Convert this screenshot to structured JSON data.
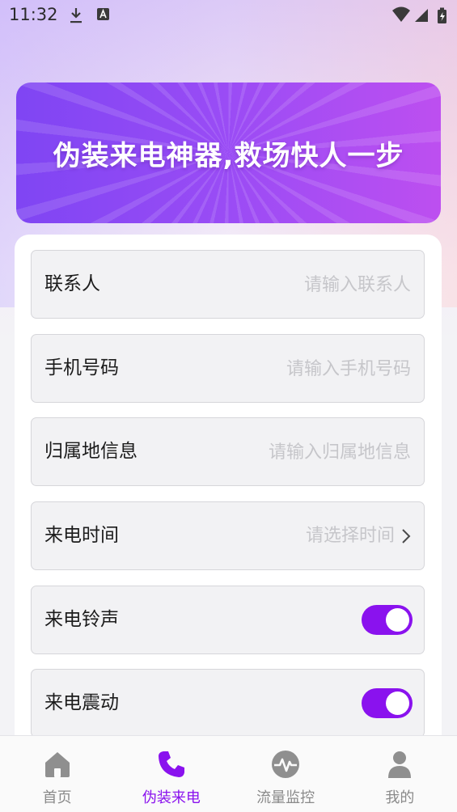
{
  "status_bar": {
    "time": "11:32",
    "icons": [
      "download-icon",
      "a-notification-icon",
      "wifi-icon",
      "cell-signal-icon",
      "battery-charging-icon"
    ]
  },
  "banner": {
    "text": "伪装来电神器,救场快人一步"
  },
  "form": {
    "contact": {
      "label": "联系人",
      "placeholder": "请输入联系人"
    },
    "phone": {
      "label": "手机号码",
      "placeholder": "请输入手机号码"
    },
    "location": {
      "label": "归属地信息",
      "placeholder": "请输入归属地信息"
    },
    "call_time": {
      "label": "来电时间",
      "value": "请选择时间"
    },
    "ringtone": {
      "label": "来电铃声",
      "enabled": true
    },
    "vibration": {
      "label": "来电震动",
      "enabled": true
    }
  },
  "tabs": [
    {
      "label": "首页",
      "icon": "home-icon",
      "active": false
    },
    {
      "label": "伪装来电",
      "icon": "phone-icon",
      "active": true
    },
    {
      "label": "流量监控",
      "icon": "pulse-icon",
      "active": false
    },
    {
      "label": "我的",
      "icon": "user-icon",
      "active": false
    }
  ],
  "colors": {
    "accent": "#8a12ee",
    "inactive_tab": "#8a8a8a",
    "banner_start": "#7f45f3",
    "banner_end": "#bd4ff0"
  }
}
